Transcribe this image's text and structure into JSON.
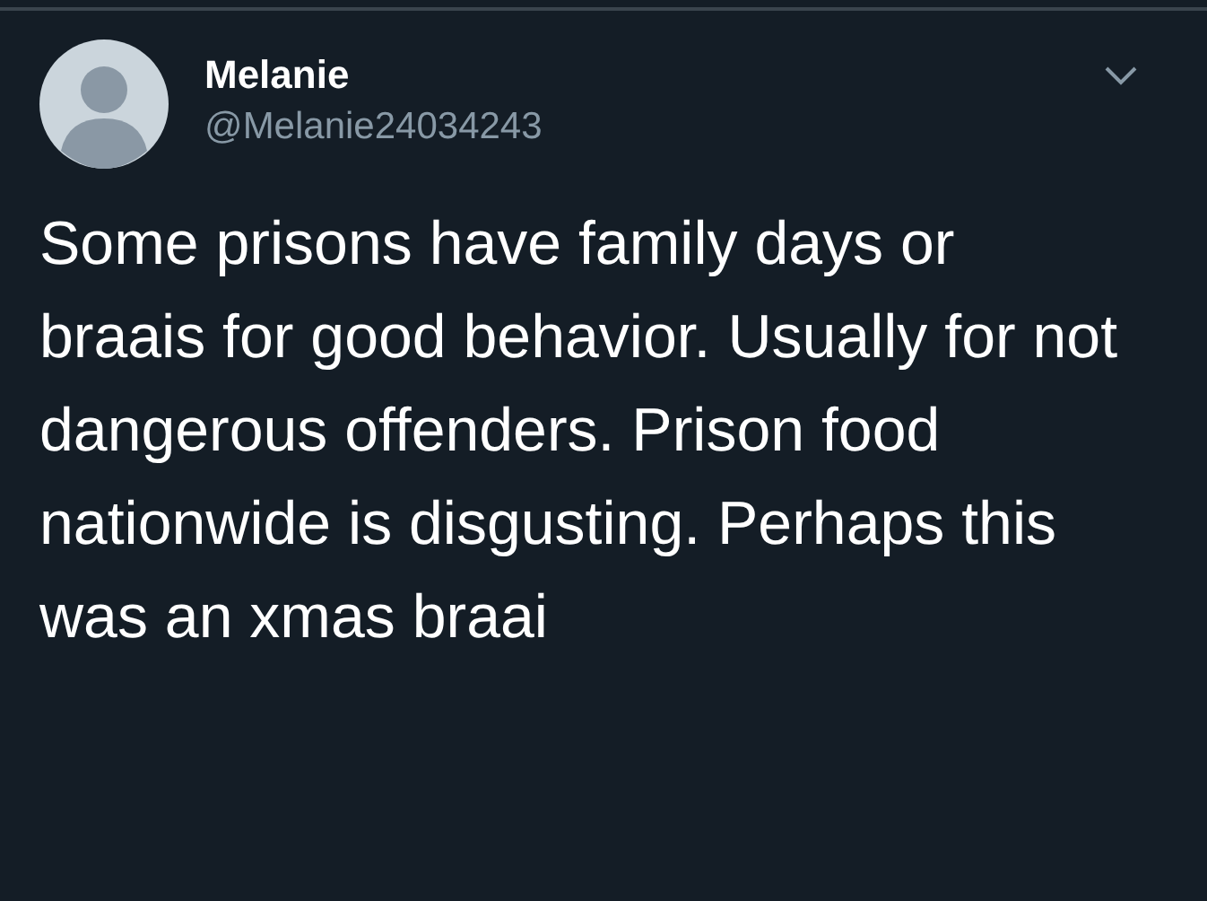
{
  "tweet": {
    "name": "Melanie",
    "handle": "@Melanie24034243",
    "text": "Some prisons have family days or braais for good behavior. Usually for not dangerous offenders. Prison food nationwide is disgusting. Perhaps this was an xmas braai"
  }
}
